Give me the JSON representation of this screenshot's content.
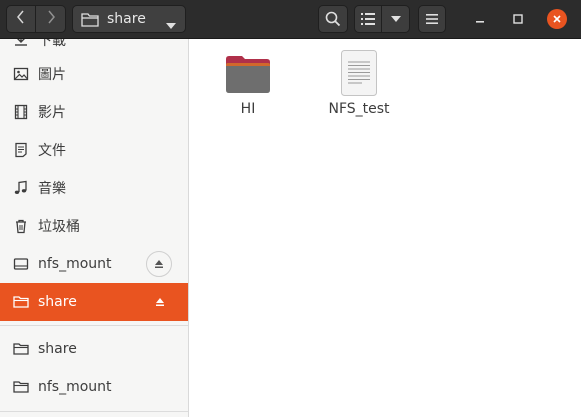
{
  "header": {
    "path_label": "share",
    "icons": {
      "back": "chevron-left-icon",
      "forward": "chevron-right-icon",
      "folder": "folder-icon",
      "path_dropdown": "caret-down-icon",
      "search": "search-icon",
      "view_list": "list-view-icon",
      "view_options": "caret-down-icon",
      "menu": "hamburger-menu-icon",
      "minimize": "minimize-icon",
      "maximize": "maximize-icon",
      "close": "close-icon"
    }
  },
  "sidebar": {
    "items": [
      {
        "label": "下載",
        "icon": "download-icon"
      },
      {
        "label": "圖片",
        "icon": "pictures-icon"
      },
      {
        "label": "影片",
        "icon": "videos-icon"
      },
      {
        "label": "文件",
        "icon": "documents-icon"
      },
      {
        "label": "音樂",
        "icon": "music-icon"
      },
      {
        "label": "垃圾桶",
        "icon": "trash-icon"
      },
      {
        "label": "nfs_mount",
        "icon": "drive-icon",
        "eject": true
      },
      {
        "label": "share",
        "icon": "network-folder-icon",
        "eject": true,
        "active": true
      },
      {
        "label": "share",
        "icon": "network-folder-icon"
      },
      {
        "label": "nfs_mount",
        "icon": "network-folder-icon"
      }
    ]
  },
  "files": [
    {
      "name": "HI",
      "type": "folder",
      "icon": "folder-icon"
    },
    {
      "name": "NFS_test",
      "type": "text-document",
      "icon": "text-document-icon"
    }
  ],
  "colors": {
    "accent": "#e95420",
    "header_bg": "#2c2c2c",
    "sidebar_bg": "#f6f6f5",
    "folder_body": "#6e6e6e",
    "folder_tab": "#b0304a"
  }
}
